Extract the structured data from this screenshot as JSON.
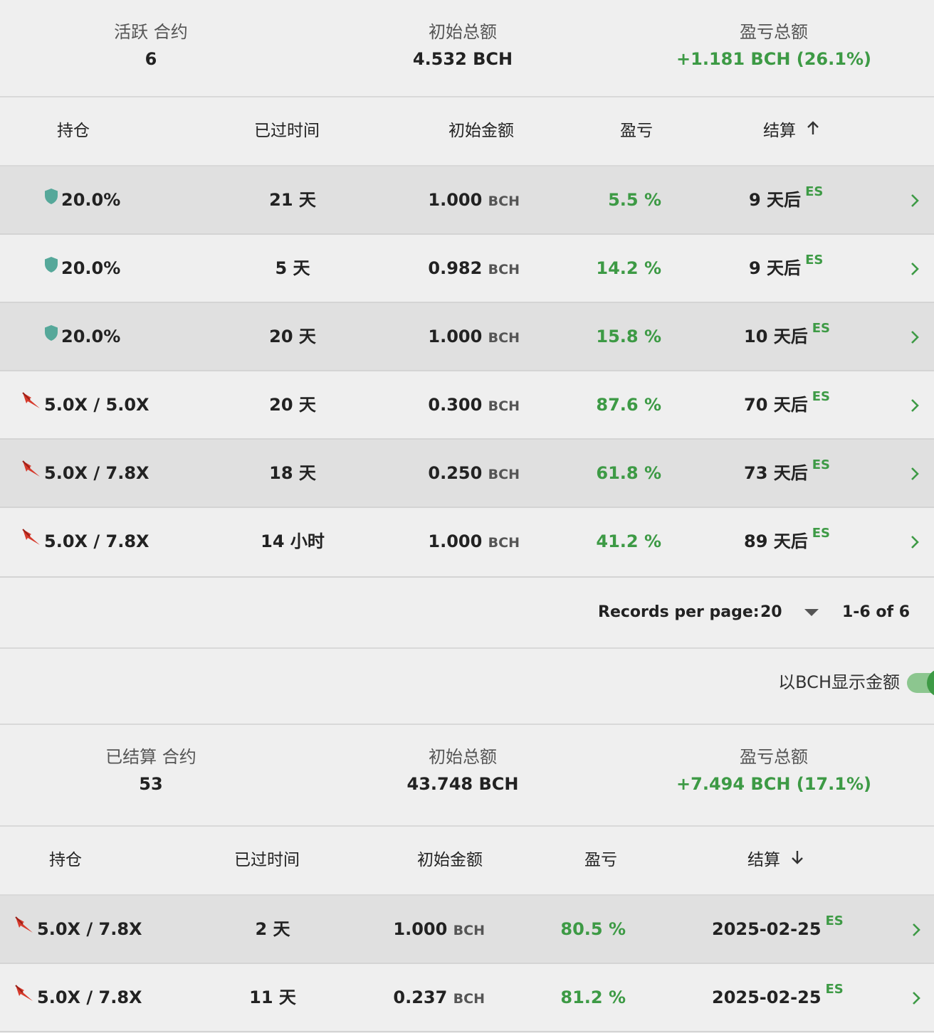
{
  "active": {
    "summary": {
      "contracts_label": "活跃 合约",
      "contracts_value": "6",
      "initial_label": "初始总额",
      "initial_value": "4.532 BCH",
      "pnl_label": "盈亏总额",
      "pnl_value": "+1.181 BCH (26.1%)"
    },
    "headers": {
      "position": "持仓",
      "elapsed": "已过时间",
      "initial": "初始金额",
      "pnl": "盈亏",
      "settle": "结算"
    },
    "rows": [
      {
        "position": "20.0%",
        "icon": "shield-icon",
        "elapsed": "21 天",
        "amount": "1.000",
        "unit": "BCH",
        "pnl": "5.5 %",
        "settle": "9 天后",
        "tag": "ES"
      },
      {
        "position": "20.0%",
        "icon": "shield-icon",
        "elapsed": "5 天",
        "amount": "0.982",
        "unit": "BCH",
        "pnl": "14.2 %",
        "settle": "9 天后",
        "tag": "ES"
      },
      {
        "position": "20.0%",
        "icon": "shield-icon",
        "elapsed": "20 天",
        "amount": "1.000",
        "unit": "BCH",
        "pnl": "15.8 %",
        "settle": "10 天后",
        "tag": "ES"
      },
      {
        "position": "5.0X / 5.0X",
        "icon": "leverage-icon",
        "elapsed": "20 天",
        "amount": "0.300",
        "unit": "BCH",
        "pnl": "87.6 %",
        "settle": "70 天后",
        "tag": "ES"
      },
      {
        "position": "5.0X / 7.8X",
        "icon": "leverage-icon",
        "elapsed": "18 天",
        "amount": "0.250",
        "unit": "BCH",
        "pnl": "61.8 %",
        "settle": "73 天后",
        "tag": "ES"
      },
      {
        "position": "5.0X / 7.8X",
        "icon": "leverage-icon",
        "elapsed": "14 小时",
        "amount": "1.000",
        "unit": "BCH",
        "pnl": "41.2 %",
        "settle": "89 天后",
        "tag": "ES"
      }
    ],
    "pager": {
      "label": "Records per page:",
      "per_page": "20",
      "range": "1-6 of 6"
    }
  },
  "toggle": {
    "label": "以BCH显示金额",
    "on": true
  },
  "settled": {
    "summary": {
      "contracts_label": "已结算 合约",
      "contracts_value": "53",
      "initial_label": "初始总额",
      "initial_value": "43.748 BCH",
      "pnl_label": "盈亏总额",
      "pnl_value": "+7.494 BCH (17.1%)"
    },
    "headers": {
      "position": "持仓",
      "elapsed": "已过时间",
      "initial": "初始金额",
      "pnl": "盈亏",
      "settle": "结算"
    },
    "rows": [
      {
        "position": "5.0X / 7.8X",
        "icon": "leverage-icon",
        "elapsed": "2 天",
        "amount": "1.000",
        "unit": "BCH",
        "pnl": "80.5 %",
        "settle": "2025-02-25",
        "tag": "ES"
      },
      {
        "position": "5.0X / 7.8X",
        "icon": "leverage-icon",
        "elapsed": "11 天",
        "amount": "0.237",
        "unit": "BCH",
        "pnl": "81.2 %",
        "settle": "2025-02-25",
        "tag": "ES"
      }
    ]
  },
  "colors": {
    "accent_green": "#3d9a45",
    "shield_teal": "#56a89a",
    "leverage_red": "#d63a2c"
  }
}
